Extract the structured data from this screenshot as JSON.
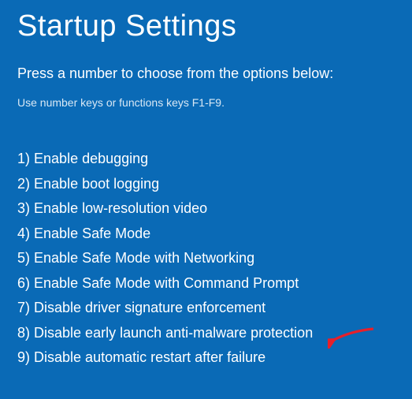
{
  "title": "Startup Settings",
  "instruction": "Press a number to choose from the options below:",
  "hint": "Use number keys or functions keys F1-F9.",
  "options": [
    {
      "num": "1)",
      "label": "Enable debugging"
    },
    {
      "num": "2)",
      "label": "Enable boot logging"
    },
    {
      "num": "3)",
      "label": "Enable low-resolution video"
    },
    {
      "num": "4)",
      "label": "Enable Safe Mode"
    },
    {
      "num": "5)",
      "label": "Enable Safe Mode with Networking"
    },
    {
      "num": "6)",
      "label": "Enable Safe Mode with Command Prompt"
    },
    {
      "num": "7)",
      "label": "Disable driver signature enforcement"
    },
    {
      "num": "8)",
      "label": "Disable early launch anti-malware protection"
    },
    {
      "num": "9)",
      "label": "Disable automatic restart after failure"
    }
  ],
  "annotation": {
    "type": "arrow",
    "color": "#e6202b",
    "points_to_option_index": 6
  }
}
